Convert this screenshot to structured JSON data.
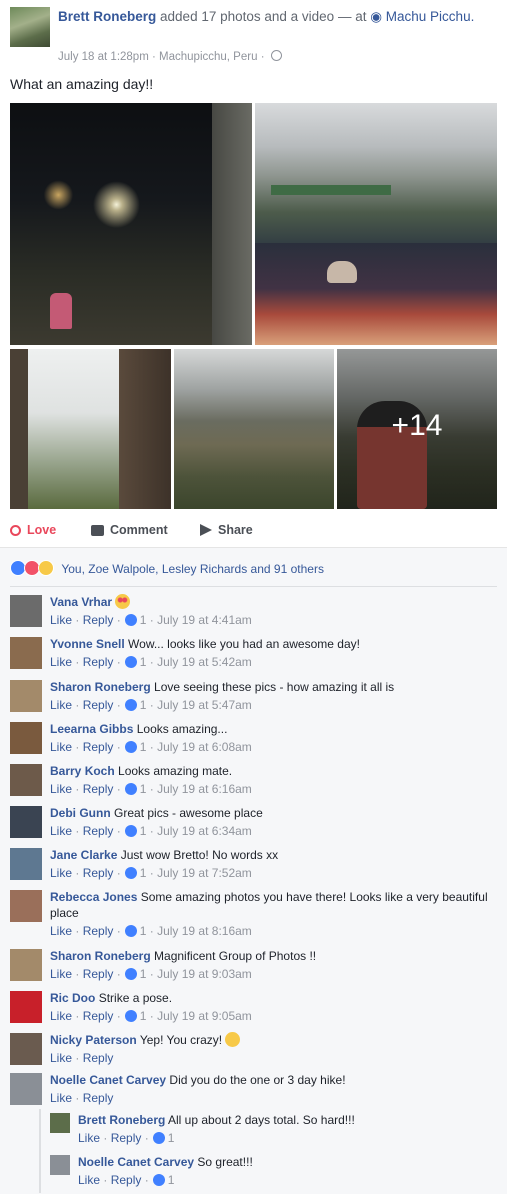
{
  "post": {
    "author": "Brett Roneberg",
    "action": "added 17 photos and a video",
    "at": "— at",
    "place": "Machu Picchu.",
    "date": "July 18 at 1:28pm",
    "location": "Machupicchu, Peru",
    "sep": "·",
    "status": "What an amazing day!!",
    "more_photos": "+14"
  },
  "actions": {
    "love": "Love",
    "comment": "Comment",
    "share": "Share"
  },
  "reactions": {
    "text": "You, Zoe Walpole, Lesley Richards and 91 others"
  },
  "comments": [
    {
      "name": "Vana Vrhar",
      "text": "",
      "emoji": "heart-eyes",
      "like": "Like",
      "reply": "Reply",
      "likes": "1",
      "time": "July 19 at 4:41am",
      "avatar": "#6b6b6b"
    },
    {
      "name": "Yvonne Snell",
      "text": "Wow... looks like you had an awesome day!",
      "like": "Like",
      "reply": "Reply",
      "likes": "1",
      "time": "July 19 at 5:42am",
      "avatar": "#8a6b4e"
    },
    {
      "name": "Sharon Roneberg",
      "text": "Love seeing these pics - how amazing it all is",
      "like": "Like",
      "reply": "Reply",
      "likes": "1",
      "time": "July 19 at 5:47am",
      "avatar": "#a38a6a"
    },
    {
      "name": "Leearna Gibbs",
      "text": "Looks amazing...",
      "like": "Like",
      "reply": "Reply",
      "likes": "1",
      "time": "July 19 at 6:08am",
      "avatar": "#7a5a3e"
    },
    {
      "name": "Barry Koch",
      "text": "Looks amazing mate.",
      "like": "Like",
      "reply": "Reply",
      "likes": "1",
      "time": "July 19 at 6:16am",
      "avatar": "#6d5a4a"
    },
    {
      "name": "Debi Gunn",
      "text": "Great pics - awesome place",
      "like": "Like",
      "reply": "Reply",
      "likes": "1",
      "time": "July 19 at 6:34am",
      "avatar": "#3a4452"
    },
    {
      "name": "Jane Clarke",
      "text": "Just wow Bretto! No words xx",
      "like": "Like",
      "reply": "Reply",
      "likes": "1",
      "time": "July 19 at 7:52am",
      "avatar": "#5e7891"
    },
    {
      "name": "Rebecca Jones",
      "text": "Some amazing photos you have there! Looks like a very beautiful place",
      "like": "Like",
      "reply": "Reply",
      "likes": "1",
      "time": "July 19 at 8:16am",
      "avatar": "#9a6f5a"
    },
    {
      "name": "Sharon Roneberg",
      "text": "Magnificent Group of Photos !!",
      "like": "Like",
      "reply": "Reply",
      "likes": "1",
      "time": "July 19 at 9:03am",
      "avatar": "#a38a6a"
    },
    {
      "name": "Ric Doo",
      "text": "Strike a pose.",
      "like": "Like",
      "reply": "Reply",
      "likes": "1",
      "time": "July 19 at 9:05am",
      "avatar": "#c8202a"
    },
    {
      "name": "Nicky Paterson",
      "text": "Yep! You crazy!",
      "emoji": "laugh",
      "like": "Like",
      "reply": "Reply",
      "likes": "",
      "time": "",
      "avatar": "#6a5b4f"
    },
    {
      "name": "Noelle Canet Carvey",
      "text": "Did you do the one or 3 day hike!",
      "like": "Like",
      "reply": "Reply",
      "likes": "",
      "time": "",
      "avatar": "#8a8f96"
    }
  ],
  "replies": [
    {
      "name": "Brett Roneberg",
      "text": "All up about 2 days total. So hard!!!",
      "like": "Like",
      "reply": "Reply",
      "likes": "1",
      "avatar": "#5c6d4a"
    },
    {
      "name": "Noelle Canet Carvey",
      "text": "So great!!!",
      "like": "Like",
      "reply": "Reply",
      "likes": "1",
      "avatar": "#8a8f96"
    }
  ],
  "colors": {
    "link": "#365899",
    "love": "#e9475b",
    "like": "#4080ff",
    "meta": "#90949c"
  }
}
